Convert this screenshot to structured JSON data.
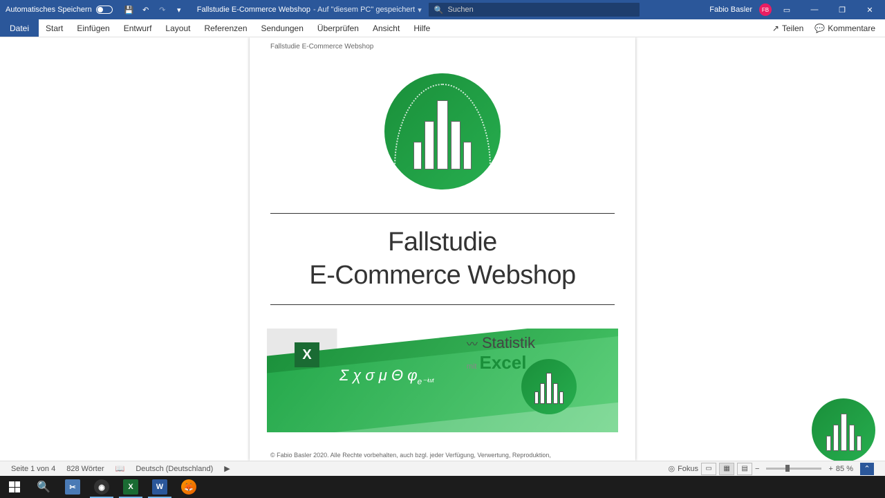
{
  "titlebar": {
    "autosave_label": "Automatisches Speichern",
    "doc_name": "Fallstudie E-Commerce Webshop",
    "saved_location": "- Auf \"diesem PC\" gespeichert",
    "search_placeholder": "Suchen",
    "user_name": "Fabio Basler",
    "user_initials": "FB"
  },
  "ribbon": {
    "tabs": [
      "Datei",
      "Start",
      "Einfügen",
      "Entwurf",
      "Layout",
      "Referenzen",
      "Sendungen",
      "Überprüfen",
      "Ansicht",
      "Hilfe"
    ],
    "share": "Teilen",
    "comments": "Kommentare"
  },
  "document": {
    "header": "Fallstudie E-Commerce Webshop",
    "title_line1": "Fallstudie",
    "title_line2": "E-Commerce Webshop",
    "banner_stat": "Statistik",
    "banner_mit": "mit",
    "banner_excel": "Excel",
    "banner_greek": "Σ χ σ μ Θ φ",
    "banner_exp": "e⁻ⁱᵚᵗ",
    "excel_letter": "X",
    "copyright": "© Fabio Basler 2020. Alle Rechte vorbehalten, auch bzgl. jeder Verfügung, Verwertung, Reproduktion,"
  },
  "statusbar": {
    "page": "Seite 1 von 4",
    "words": "828 Wörter",
    "language": "Deutsch (Deutschland)",
    "focus": "Fokus",
    "zoom": "85 %"
  }
}
